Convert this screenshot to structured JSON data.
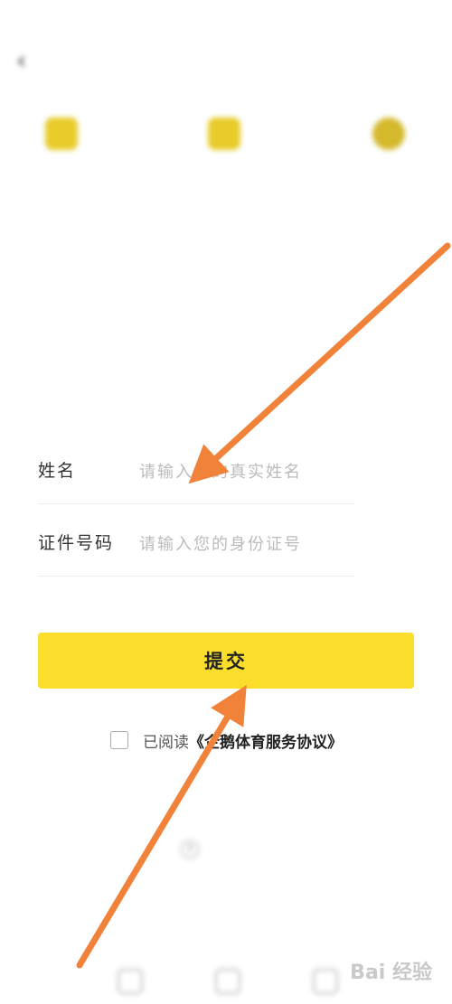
{
  "status_bar": {
    "time": "",
    "icons": ""
  },
  "header": {
    "title": "",
    "back_icon": "chevron-left-icon"
  },
  "steps": [
    {
      "label": "",
      "icon": "card-icon"
    },
    {
      "label": "",
      "icon": "id-card-icon"
    },
    {
      "label": "",
      "icon": "face-icon"
    }
  ],
  "form": {
    "phone": {
      "label": "",
      "value": ""
    },
    "resend_label": "",
    "verify_code": {
      "label": "",
      "placeholder": ""
    },
    "name": {
      "label": "姓名",
      "placeholder": "请输入您的真实姓名"
    },
    "id_number": {
      "label": "证件号码",
      "placeholder": "请输入您的身份证号"
    }
  },
  "submit_label": "提交",
  "agreement": {
    "prefix": "已阅读",
    "link": "《企鹅体育服务协议》"
  },
  "help_label": "",
  "watermark": "Bai 经验",
  "colors": {
    "submit": "#fbdd2c",
    "arrow": "#f0823a",
    "resend": "#e96a5a"
  }
}
